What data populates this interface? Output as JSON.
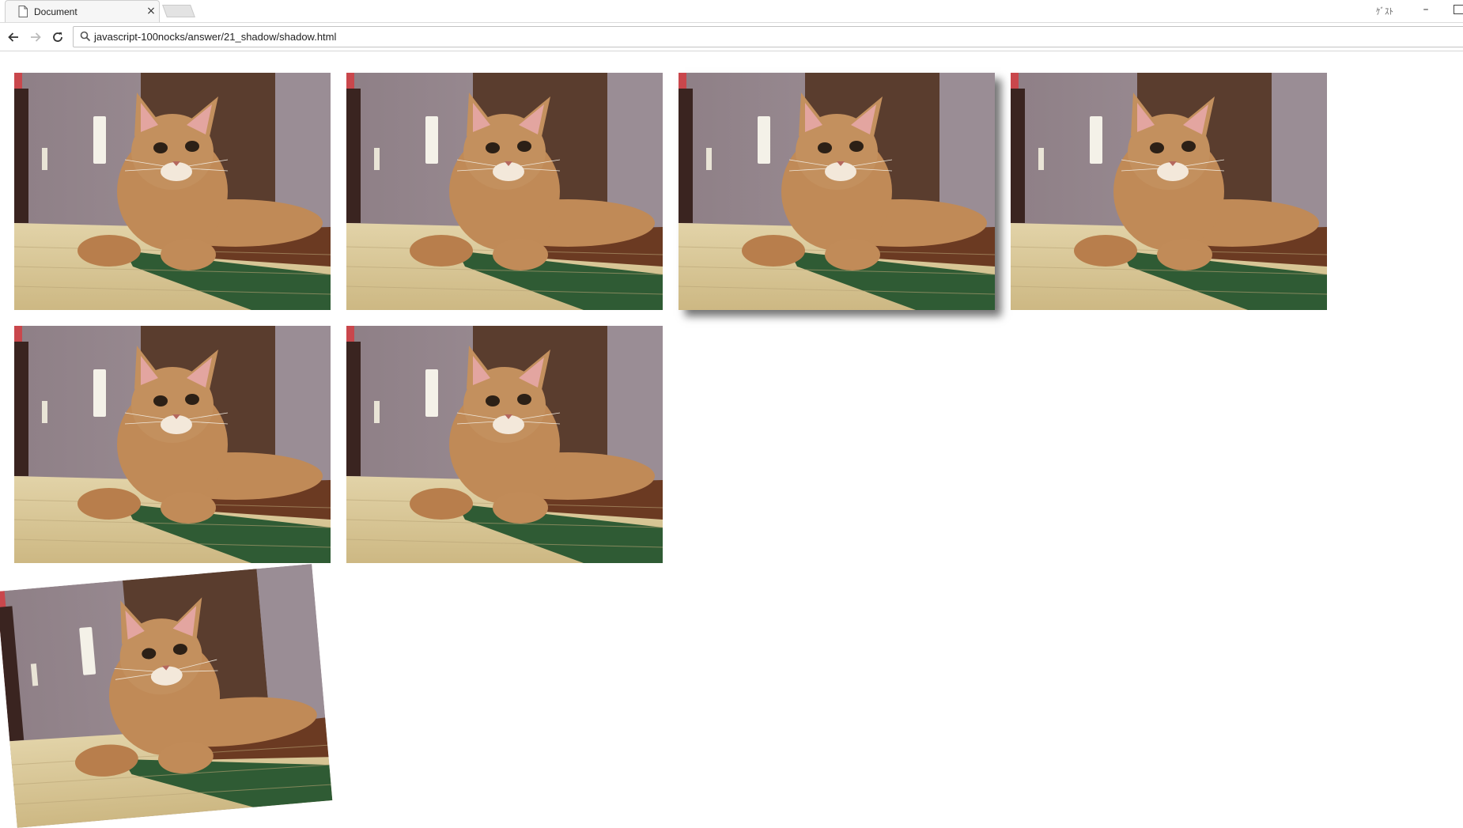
{
  "tab": {
    "title": "Document",
    "close_symbol": "×",
    "icon": "page-icon"
  },
  "window": {
    "profile_label": "ｹﾞｽﾄ",
    "minimize_symbol": "–"
  },
  "toolbar": {
    "back_icon": "arrow-left-icon",
    "forward_icon": "arrow-right-icon",
    "reload_icon": "reload-icon",
    "search_icon": "search-icon",
    "url": "javascript-100nocks/answer/21_shadow/shadow.html"
  },
  "images": [
    {
      "description": "cat photo",
      "effect": "none"
    },
    {
      "description": "cat photo",
      "effect": "none"
    },
    {
      "description": "cat photo",
      "effect": "box-shadow"
    },
    {
      "description": "cat photo",
      "effect": "none"
    },
    {
      "description": "cat photo",
      "effect": "none"
    },
    {
      "description": "cat photo",
      "effect": "none"
    },
    {
      "description": "cat photo",
      "effect": "rotate"
    }
  ],
  "colors": {
    "wall_left": "#8e7f86",
    "wall_dark": "#5a3d2e",
    "wall_right": "#9a8d95",
    "floor": "#d8c79a",
    "rug_green": "#2f5b34",
    "cat_fur": "#c08a57",
    "accent_red": "#c9474c"
  }
}
